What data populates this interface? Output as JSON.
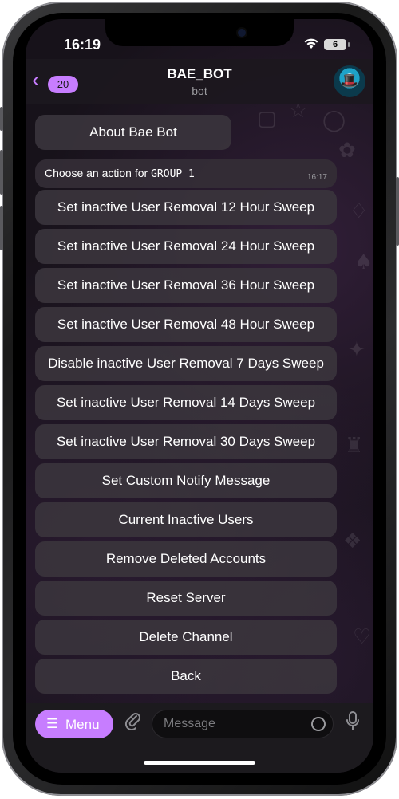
{
  "status_bar": {
    "time": "16:19",
    "battery_level": "6"
  },
  "header": {
    "unread_count": "20",
    "title": "BAE_BOT",
    "subtitle": "bot"
  },
  "chat": {
    "about_button": "About Bae Bot",
    "message": {
      "text_prefix": "Choose an action for ",
      "text_group": "GROUP 1",
      "time": "16:17"
    },
    "buttons": [
      "Set inactive User Removal 12 Hour Sweep",
      "Set inactive User Removal 24 Hour Sweep",
      "Set inactive User Removal 36 Hour Sweep",
      "Set inactive User Removal 48 Hour Sweep",
      "Disable inactive User Removal 7 Days Sweep",
      "Set inactive User Removal 14 Days Sweep",
      "Set inactive User Removal 30 Days Sweep",
      "Set Custom Notify Message",
      "Current Inactive Users",
      "Remove Deleted Accounts",
      "Reset Server",
      "Delete Channel",
      "Back"
    ]
  },
  "input_bar": {
    "menu_label": "Menu",
    "placeholder": "Message"
  },
  "colors": {
    "accent": "#c77dff",
    "button_bg": "#3a343c",
    "background": "#17121a"
  }
}
